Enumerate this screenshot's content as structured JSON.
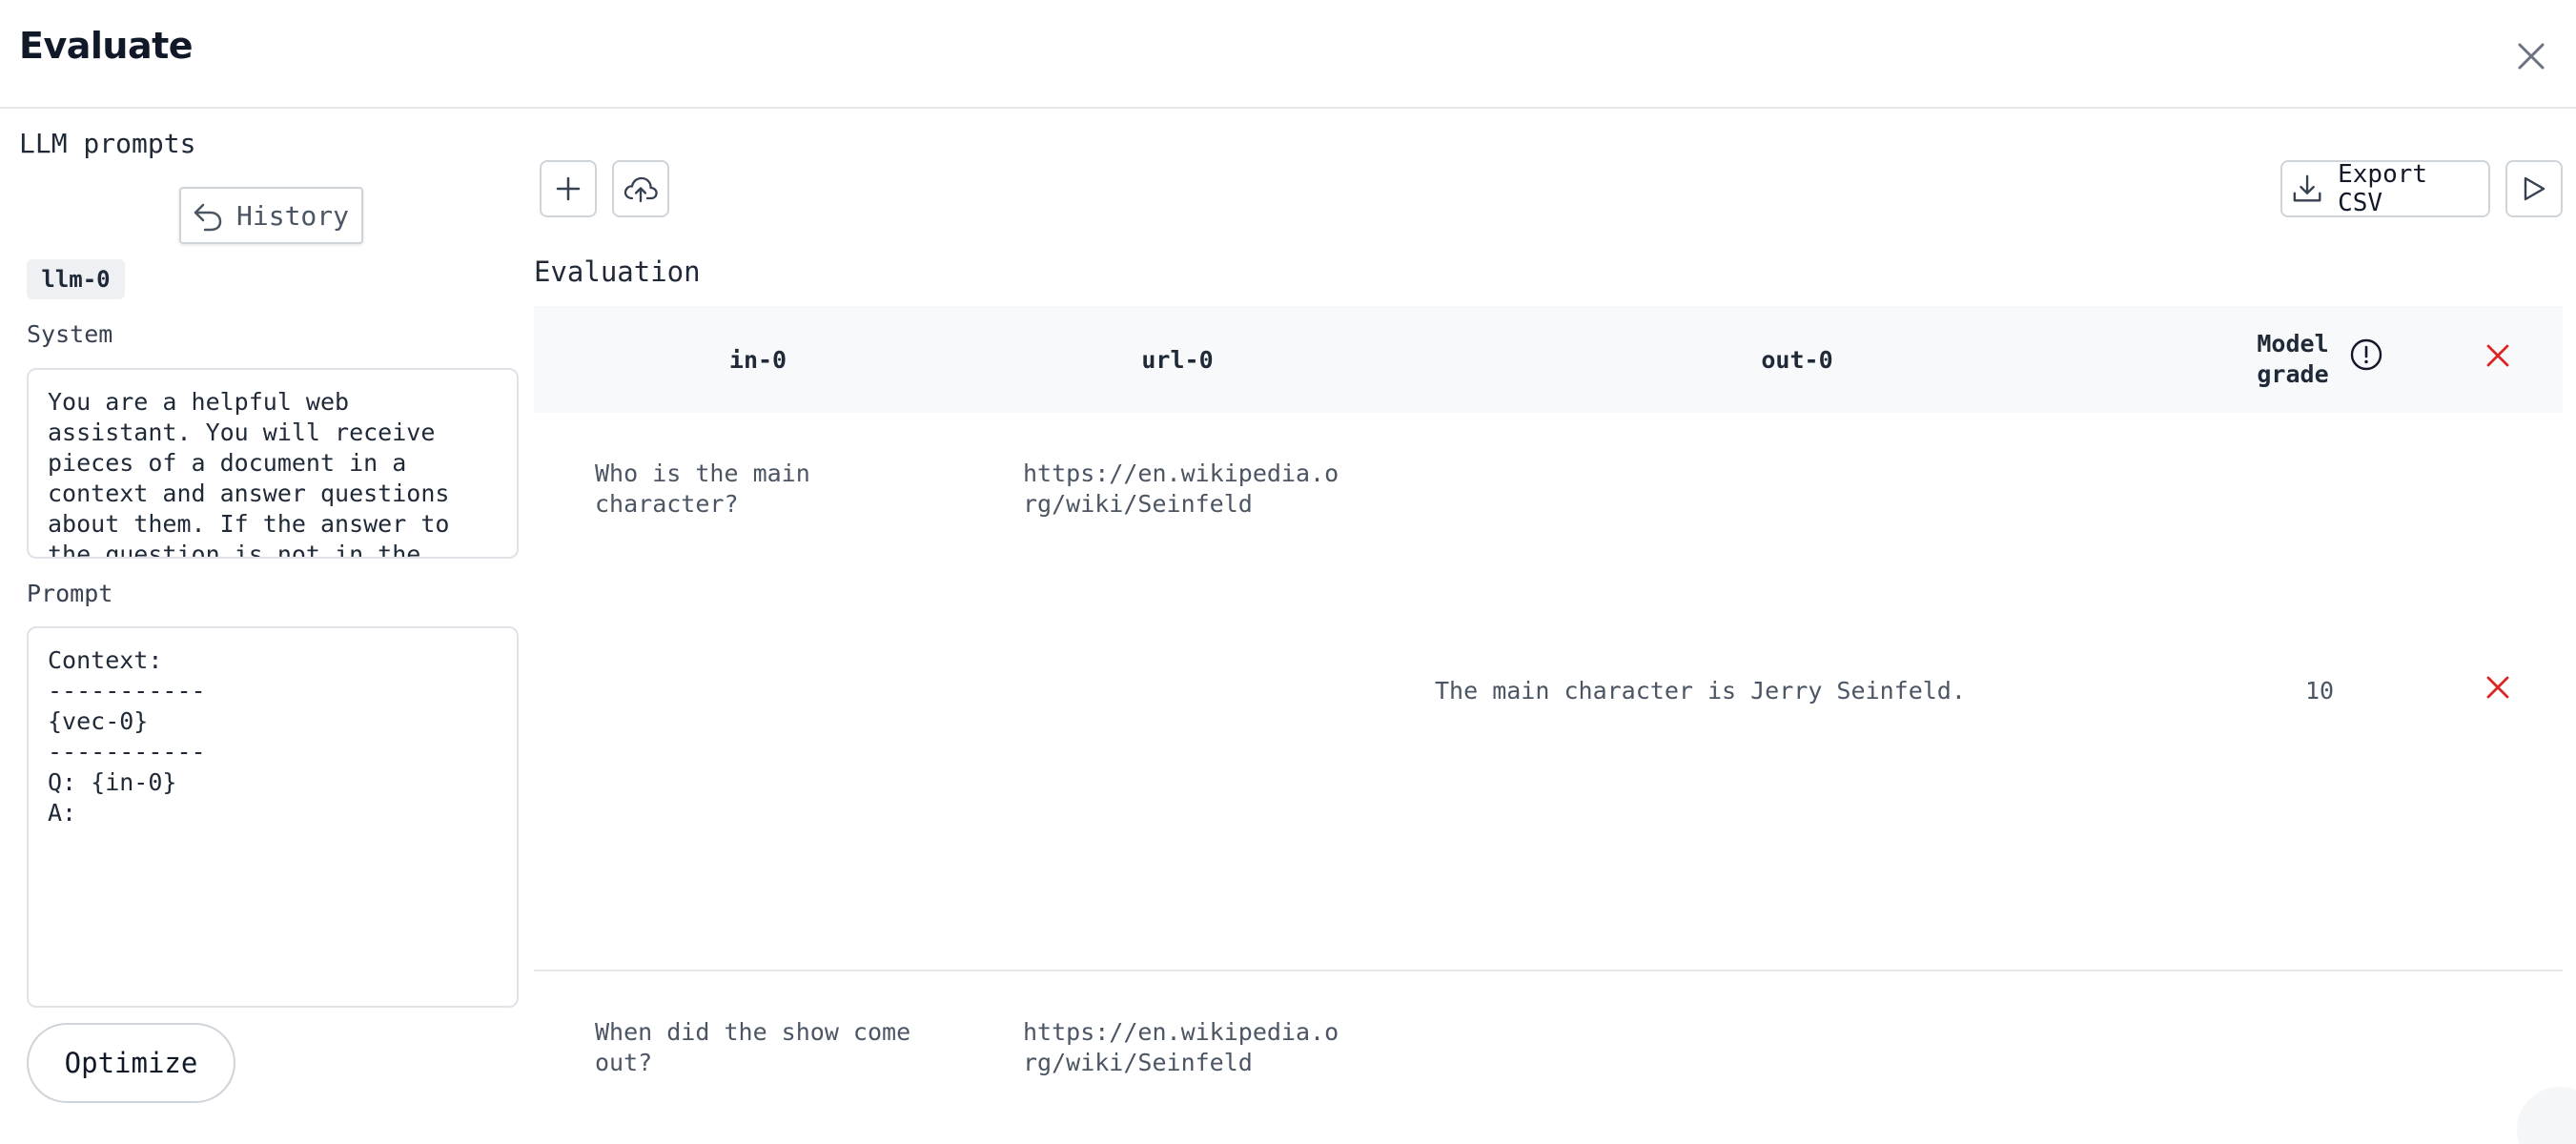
{
  "dialog": {
    "title": "Evaluate"
  },
  "left_panel": {
    "title": "LLM prompts",
    "history_label": "History",
    "llm_badge": "llm-0",
    "system_label": "System",
    "system_value": "You are a helpful web assistant. You will receive pieces of a document in a context and answer questions about them. If the answer to the question is not in the context, do not answer.",
    "prompt_label": "Prompt",
    "prompt_value": "Context:\n-----------\n{vec-0}\n-----------\nQ: {in-0}\nA:",
    "optimize_label": "Optimize"
  },
  "toolbar": {
    "export_label": "Export CSV"
  },
  "evaluation": {
    "title": "Evaluation",
    "columns": {
      "in": "in-0",
      "url": "url-0",
      "out": "out-0",
      "grade_line1": "Model",
      "grade_line2": "grade"
    },
    "rows": [
      {
        "in_line1": "Who is the main",
        "in_line2": "character?",
        "url_line1": "https://en.wikipedia.o",
        "url_line2": "rg/wiki/Seinfeld",
        "out": "The main character is Jerry Seinfeld.",
        "grade": "10"
      },
      {
        "in_line1": "When did the show come",
        "in_line2": "out?",
        "url_line1": "https://en.wikipedia.o",
        "url_line2": "rg/wiki/Seinfeld"
      }
    ]
  },
  "colors": {
    "accent_delete": "#dc2626",
    "border": "#cfd4da",
    "header_bg": "#f8f9fb"
  }
}
